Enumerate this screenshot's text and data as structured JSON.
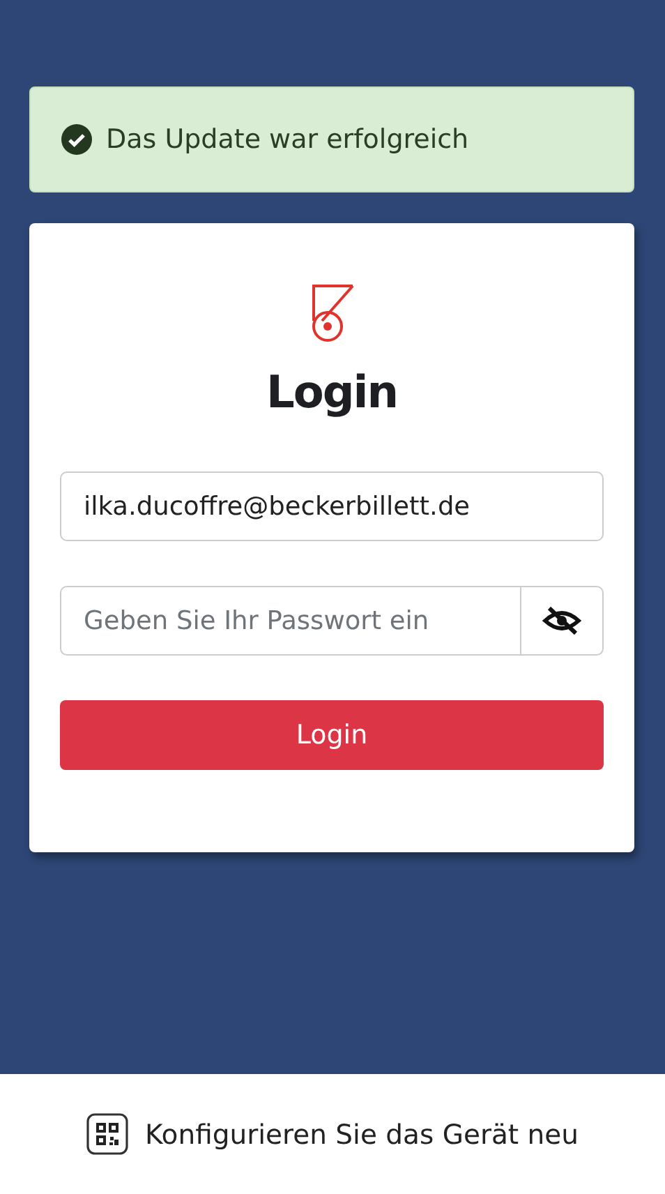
{
  "alert": {
    "kind": "success",
    "message": "Das Update war erfolgreich"
  },
  "login": {
    "title": "Login",
    "email": {
      "value": "ilka.ducoffre@beckerbillett.de"
    },
    "password": {
      "placeholder": "Geben Sie Ihr Passwort ein",
      "visible": false
    },
    "submit": "Login"
  },
  "footer": {
    "link": "Konfigurieren Sie das Gerät neu"
  }
}
